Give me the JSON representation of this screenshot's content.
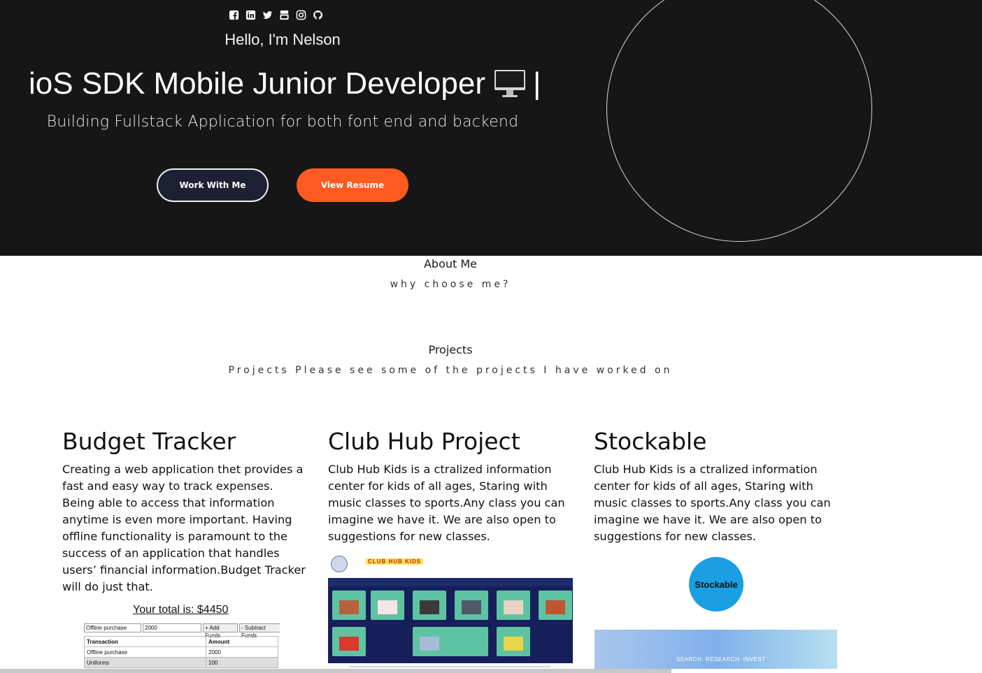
{
  "hero": {
    "socials": [
      "facebook-icon",
      "linkedin-icon",
      "twitter-icon",
      "youtube-icon",
      "instagram-icon",
      "github-icon"
    ],
    "greeting": "Hello, I'm Nelson",
    "title": "ioS SDK Mobile Junior Developer",
    "cursor": "|",
    "subtitle": "Building Fullstack Application for both font end and backend",
    "work_button": "Work With Me",
    "resume_button": "View Resume",
    "colors": {
      "background": "#161616",
      "resume_button": "#ff5a1f",
      "work_button": "#1d2033"
    }
  },
  "about": {
    "title": "About Me",
    "subtitle": "why choose me?"
  },
  "projects": {
    "title": "Projects",
    "subtitle": "Projects Please see some of the projects I have worked on",
    "items": [
      {
        "name": "Budget Tracker",
        "description": "Creating a web application thet provides a fast and easy way to track expenses. Being able to access that information anytime is even more important. Having offline functionality is paramount to the success of an application that handles users’ financial information.Budget Tracker will do just that."
      },
      {
        "name": "Club Hub Project",
        "description": "Club Hub Kids is a ctralized information center for kids of all ages, Staring with music classes to sports.Any class you can imagine we have it. We are also open to suggestions for new classes."
      },
      {
        "name": "Stockable",
        "description": "Club Hub Kids is a ctralized information center for kids of all ages, Staring with music classes to sports.Any class you can imagine we have it. We are also open to suggestions for new classes."
      }
    ]
  },
  "budget_screenshot": {
    "total": "Your total is: $4450",
    "name_input": "Offline purchase",
    "amount_input": "2000",
    "add_button": "+ Add Funds",
    "subtract_button": "- Subtract Funds",
    "headers": [
      "Transaction",
      "Amount"
    ],
    "rows": [
      [
        "Offline purchase",
        "2000"
      ],
      [
        "Uniforms",
        "100"
      ]
    ]
  },
  "club_screenshot": {
    "logo_text": "CLUB HUB KIDS"
  },
  "stock_screenshot": {
    "logo_text": "Stockable",
    "banner_text": "SEARCH. RESEARCH. INVEST"
  }
}
